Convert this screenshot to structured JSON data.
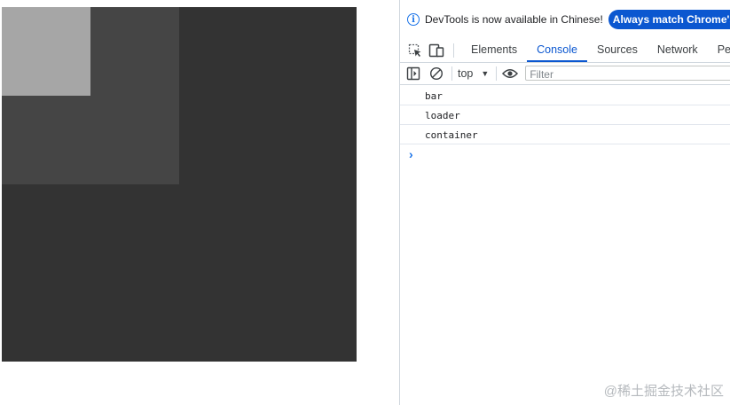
{
  "preview": {
    "container_color": "#333333",
    "loader_color": "#454545",
    "bar_color": "#a6a6a6"
  },
  "infobar": {
    "icon": "info-icon",
    "message": "DevTools is now available in Chinese!",
    "button_label": "Always match Chrome's la"
  },
  "toolbar_icons": [
    "inspect-element-icon",
    "device-toolbar-icon"
  ],
  "tabs": [
    {
      "label": "Elements",
      "active": false
    },
    {
      "label": "Console",
      "active": true
    },
    {
      "label": "Sources",
      "active": false
    },
    {
      "label": "Network",
      "active": false
    },
    {
      "label": "Perfo",
      "active": false
    }
  ],
  "console_toolbar": {
    "icons": [
      "sidebar-toggle-icon",
      "clear-console-icon",
      "eye-icon"
    ],
    "context": "top",
    "filter_placeholder": "Filter"
  },
  "console_messages": [
    "bar",
    "loader",
    "container"
  ],
  "prompt_symbol": "›",
  "watermark": "@稀土掘金技术社区"
}
